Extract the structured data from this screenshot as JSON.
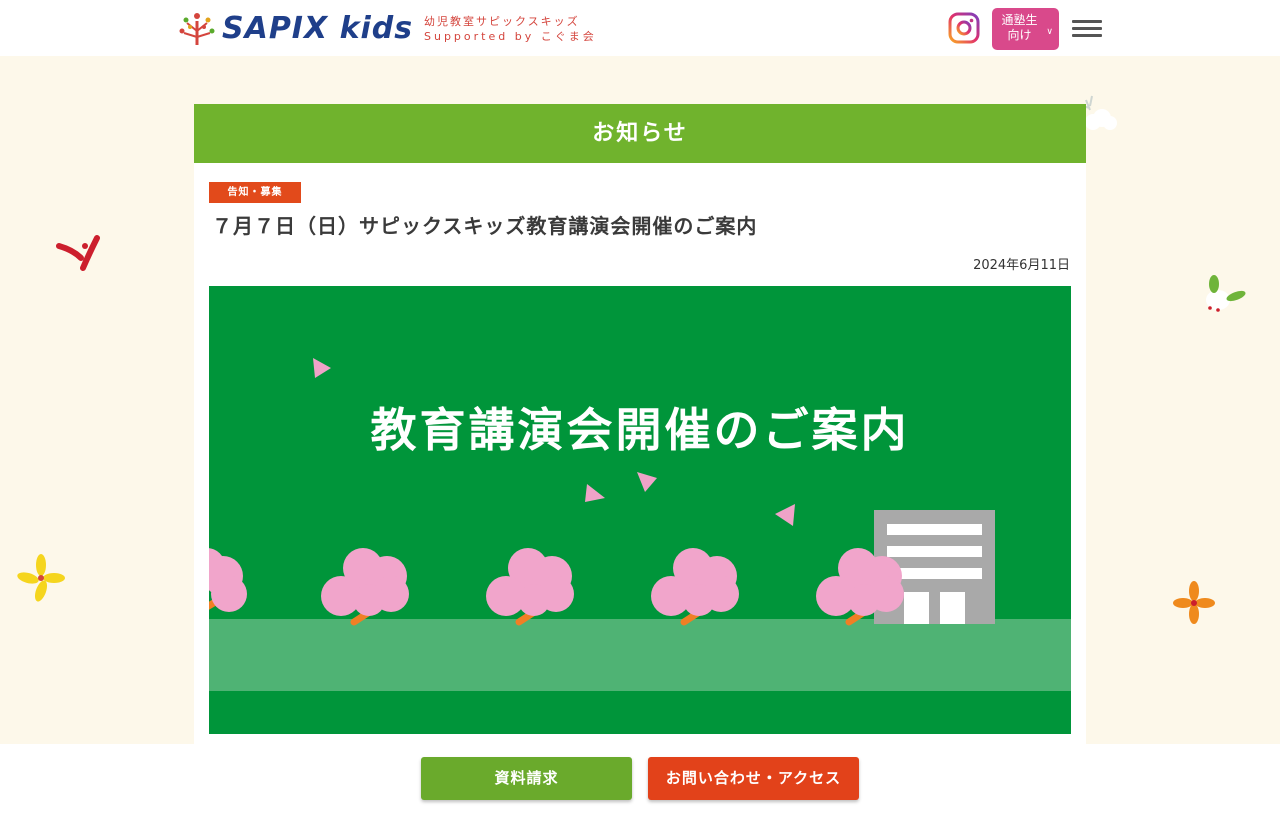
{
  "header": {
    "logo_text": "SAPIX",
    "logo_kids": "kids",
    "tagline_line1": "幼児教室サピックスキッズ",
    "tagline_line2": "Supported by こぐま会",
    "audience_button_line1": "通塾生",
    "audience_button_line2": "向け",
    "icons": {
      "instagram": "instagram-icon",
      "menu": "hamburger-menu-icon",
      "dropdown": "chevron-down-icon"
    }
  },
  "article": {
    "section_title": "お知らせ",
    "category_tag": "告知・募集",
    "title": "７月７日（日）サピックスキッズ教育講演会開催のご案内",
    "date": "2024年6月11日",
    "hero_heading": "教育講演会開催のご案内"
  },
  "footer": {
    "request_button": "資料請求",
    "contact_button": "お問い合わせ・アクセス"
  },
  "colors": {
    "brand_navy": "#1f3f8a",
    "banner_green": "#70b32d",
    "hero_green": "#00953a",
    "tag_red": "#e24a1b",
    "pill_pink": "#d9498b",
    "background": "#fdf8ea"
  }
}
